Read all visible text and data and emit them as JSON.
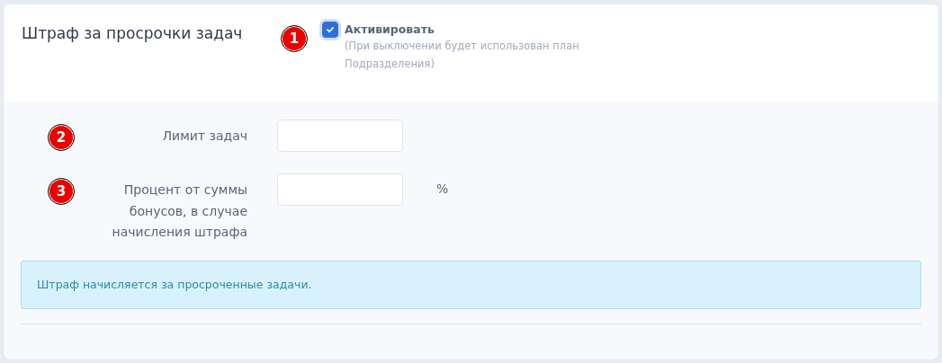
{
  "header": {
    "title": "Штраф за просрочки задач",
    "marker": "1",
    "activate": {
      "label": "Активировать",
      "checked": true,
      "hint": "(При выключении будет использован план Подразделения)"
    }
  },
  "fields": [
    {
      "marker": "2",
      "label": "Лимит задач"
    },
    {
      "marker": "3",
      "label": "Процент от суммы бонусов, в случае начисления штрафа",
      "unit": "%"
    }
  ],
  "alert": "Штраф начисляется за просроченные задачи."
}
